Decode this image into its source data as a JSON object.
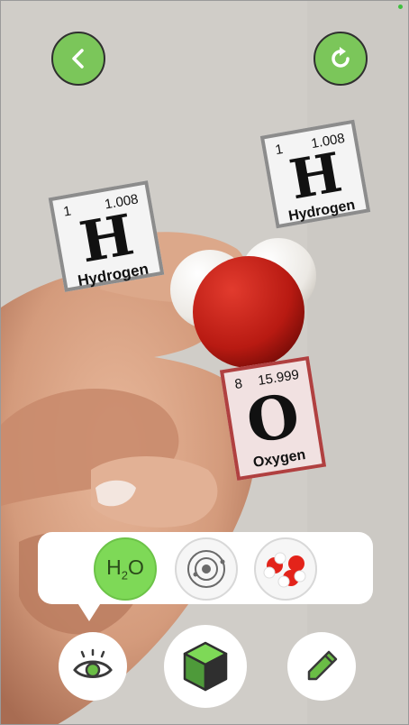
{
  "toolbar": {
    "back_icon": "chevron-left-icon",
    "reset_icon": "rotate-icon",
    "accent_color": "#7bc65a"
  },
  "element_cards": [
    {
      "atomic_number": "1",
      "atomic_mass": "1.008",
      "symbol": "H",
      "name": "Hydrogen"
    },
    {
      "atomic_number": "1",
      "atomic_mass": "1.008",
      "symbol": "H",
      "name": "Hydrogen"
    },
    {
      "atomic_number": "8",
      "atomic_mass": "15.999",
      "symbol": "O",
      "name": "Oxygen"
    }
  ],
  "view_modes": {
    "formula": {
      "main": "H",
      "subscript": "2",
      "tail": "O"
    },
    "atom_icon": "atom-orbit-icon",
    "molecule_icon": "molecule-model-icon",
    "selected": "formula"
  },
  "bottom_bar": {
    "view_icon": "eye-icon",
    "ar_icon": "cube-icon",
    "edit_icon": "pencil-icon"
  }
}
